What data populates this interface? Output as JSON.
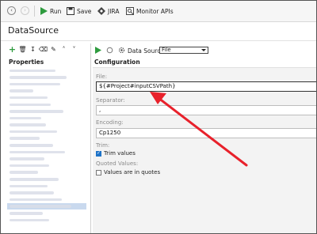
{
  "toolbar": {
    "run_label": "Run",
    "save_label": "Save",
    "jira_label": "JIRA",
    "monitor_label": "Monitor APIs"
  },
  "page": {
    "title": "DataSource"
  },
  "left": {
    "properties_title": "Properties",
    "rows": 23,
    "selected_row": 20
  },
  "right": {
    "datasource_label": "Data Source:",
    "datasource_value": "File",
    "config_title": "Configuration",
    "file_label": "File:",
    "file_value": "${#Project#inputCSVPath}",
    "separator_label": "Separator:",
    "separator_value": ",",
    "encoding_label": "Encoding:",
    "encoding_value": "Cp1250",
    "trim_label": "Trim:",
    "trim_values_label": "Trim values",
    "trim_checked": true,
    "quoted_label": "Quoted Values:",
    "quoted_values_label": "Values are in quotes",
    "quoted_checked": false
  },
  "colors": {
    "accent_green": "#2e9b3e",
    "annotation_red": "#e8212b",
    "selection": "#c9d9ee"
  }
}
